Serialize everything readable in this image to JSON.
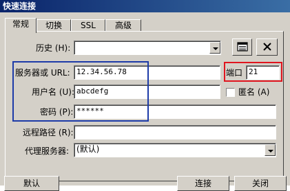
{
  "window": {
    "title": "快速连接"
  },
  "tabs": [
    {
      "label": "常规"
    },
    {
      "label": "切换"
    },
    {
      "label": "SSL"
    },
    {
      "label": "高级"
    }
  ],
  "form": {
    "history_label": "历史 (H):",
    "history_value": "",
    "server_label": "服务器或 URL:",
    "server_value": "12.34.56.78",
    "port_label": "端口",
    "port_value": "21",
    "user_label": "用户名 (U):",
    "user_value": "abcdefg",
    "anon_label": "匿名 (A)",
    "password_label": "密码 (P):",
    "password_value": "******",
    "remote_path_label": "远程路径 (R):",
    "remote_path_value": "",
    "proxy_label": "代理服务器:",
    "proxy_value": "(默认)"
  },
  "buttons": {
    "default": "默认",
    "connect": "连接",
    "close": "关闭"
  },
  "annotations": {
    "red": "#e0141e",
    "blue": "#1c3aa8"
  }
}
